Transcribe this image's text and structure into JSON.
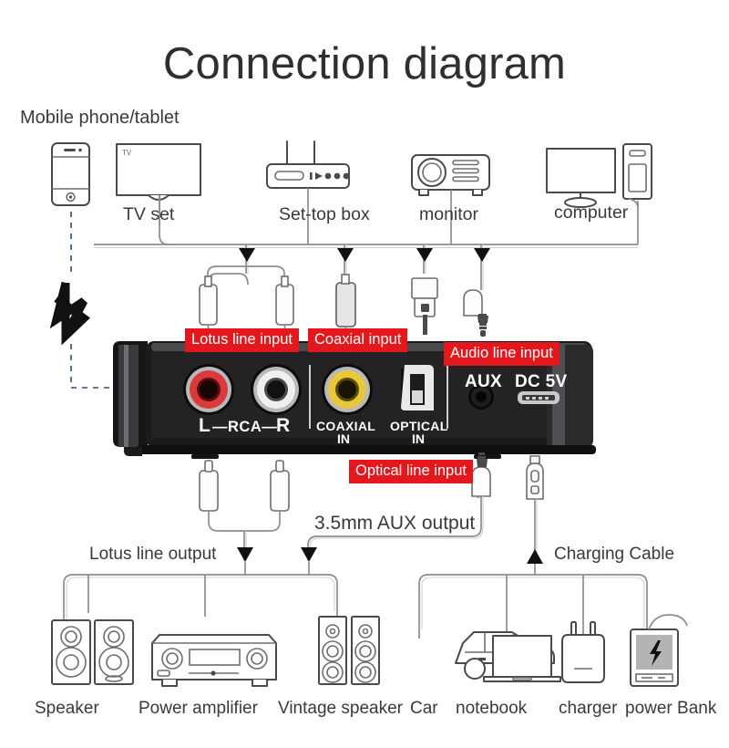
{
  "title": "Connection diagram",
  "sources": {
    "group_label": "Mobile phone/tablet",
    "devices": [
      {
        "id": "phone",
        "label": "",
        "icon": "smartphone-icon"
      },
      {
        "id": "tv",
        "label": "TV set",
        "icon": "tv-icon",
        "screen_text": "TV"
      },
      {
        "id": "settop",
        "label": "Set-top box",
        "icon": "set-top-box-icon"
      },
      {
        "id": "monitor",
        "label": "monitor",
        "icon": "projector-icon"
      },
      {
        "id": "computer",
        "label": "computer",
        "icon": "desktop-computer-icon"
      }
    ]
  },
  "wireless": {
    "icon": "bluetooth-icon",
    "label": ""
  },
  "input_tags": [
    {
      "id": "lotus",
      "label": "Lotus line input"
    },
    {
      "id": "coaxial",
      "label": "Coaxial input"
    },
    {
      "id": "audio",
      "label": "Audio line input"
    }
  ],
  "output_tags": [
    {
      "id": "optical",
      "label": "Optical line input"
    }
  ],
  "device": {
    "name": "bluetooth-audio-receiver",
    "body_color": "#1d1d1f",
    "ports": [
      {
        "id": "rca-l",
        "label": "L",
        "color": "#d93b3b",
        "type": "rca-jack"
      },
      {
        "id": "rca-group",
        "label": "—RCA—",
        "type": "text"
      },
      {
        "id": "rca-r",
        "label": "R",
        "color": "#e9e9e9",
        "type": "rca-jack"
      },
      {
        "id": "coaxial",
        "label": "COAXIAL",
        "sublabel": "IN",
        "color": "#e8c73a",
        "type": "rca-jack"
      },
      {
        "id": "optical",
        "label": "OPTICAL",
        "sublabel": "IN",
        "type": "toslink"
      },
      {
        "id": "aux",
        "label": "AUX",
        "type": "3.5mm-jack"
      },
      {
        "id": "power",
        "label": "DC 5V",
        "type": "micro-usb"
      }
    ]
  },
  "output_labels": [
    {
      "id": "lotus-out",
      "label": "Lotus line output"
    },
    {
      "id": "aux-out",
      "label": "3.5mm AUX output"
    },
    {
      "id": "charging",
      "label": "Charging Cable"
    }
  ],
  "sinks": [
    {
      "id": "speaker",
      "label": "Speaker",
      "icon": "bookshelf-speakers-icon"
    },
    {
      "id": "amplifier",
      "label": "Power amplifier",
      "icon": "av-receiver-icon"
    },
    {
      "id": "vintage-speaker",
      "label": "Vintage speaker",
      "icon": "tower-speakers-icon"
    },
    {
      "id": "car",
      "label": "Car",
      "icon": "car-icon"
    },
    {
      "id": "notebook",
      "label": "notebook",
      "icon": "laptop-icon"
    },
    {
      "id": "charger",
      "label": "charger",
      "icon": "wall-charger-icon"
    },
    {
      "id": "powerbank",
      "label": "power Bank",
      "icon": "power-bank-icon"
    }
  ],
  "colors": {
    "tag_red": "#e4181c",
    "rca_left": "#d93b3b",
    "rca_right": "#e9e9e9",
    "coaxial_yellow": "#e8c73a",
    "bluetooth_line": "#2b4a78",
    "cable": "#8d8d8d"
  }
}
